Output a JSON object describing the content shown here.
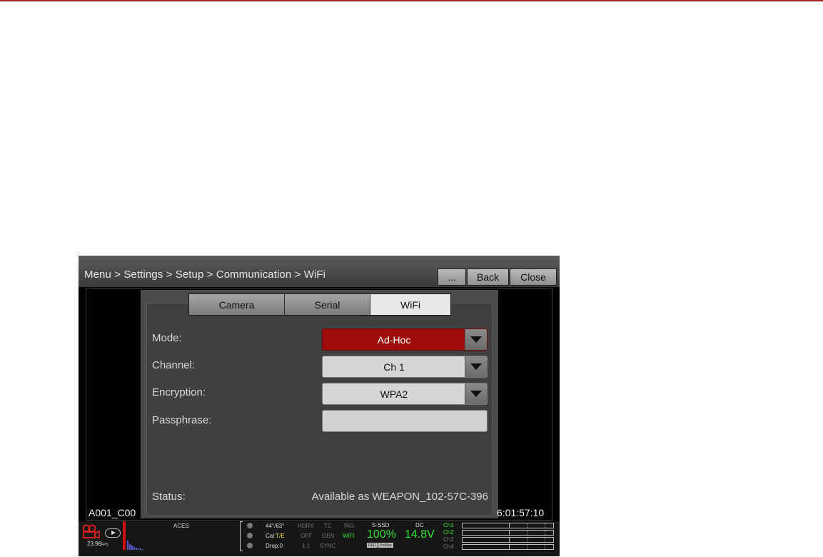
{
  "header": {
    "breadcrumb": "Menu > Settings > Setup > Communication > WiFi",
    "more_label": "...",
    "back_label": "Back",
    "close_label": "Close"
  },
  "tabs": [
    {
      "label": "Camera",
      "active": false
    },
    {
      "label": "Serial",
      "active": false
    },
    {
      "label": "WiFi",
      "active": true
    }
  ],
  "form": {
    "mode": {
      "label": "Mode:",
      "value": "Ad-Hoc"
    },
    "channel": {
      "label": "Channel:",
      "value": "Ch 1"
    },
    "encryption": {
      "label": "Encryption:",
      "value": "WPA2"
    },
    "passphrase": {
      "label": "Passphrase:",
      "value": ""
    }
  },
  "status": {
    "label": "Status:",
    "value": "Available as WEAPON_102-57C-396"
  },
  "overlay": {
    "clip": "A001_C00",
    "timecode": "6:01:57:10"
  },
  "strip": {
    "fps_value": "23.98",
    "fps_unit": "FPS",
    "color_space": "ACES",
    "temp_prefix": "44°/63°",
    "cal_prefix": "Cal:",
    "cal_value": "T/E",
    "drop": "Drop:0",
    "hdrx_label": "HDRX",
    "hdrx_value": "OFF",
    "ratio": "1:1",
    "tc_label": "TC",
    "tc_gen": "GEN",
    "tc_sync": "SYNC",
    "rig_label": "RIG",
    "rig_value": "WIFI",
    "media_label": "S-SSD",
    "media_value": "100%",
    "media_badge1": "RED",
    "media_badge2": "ProRes",
    "power_label": "DC",
    "power_value": "14.8V",
    "audio_channels": [
      "Ch1",
      "Ch2",
      "Ch3",
      "Ch4"
    ]
  },
  "colors": {
    "accent_red": "#9e0c0c",
    "rec_red": "#d01010",
    "status_green": "#31e331"
  }
}
